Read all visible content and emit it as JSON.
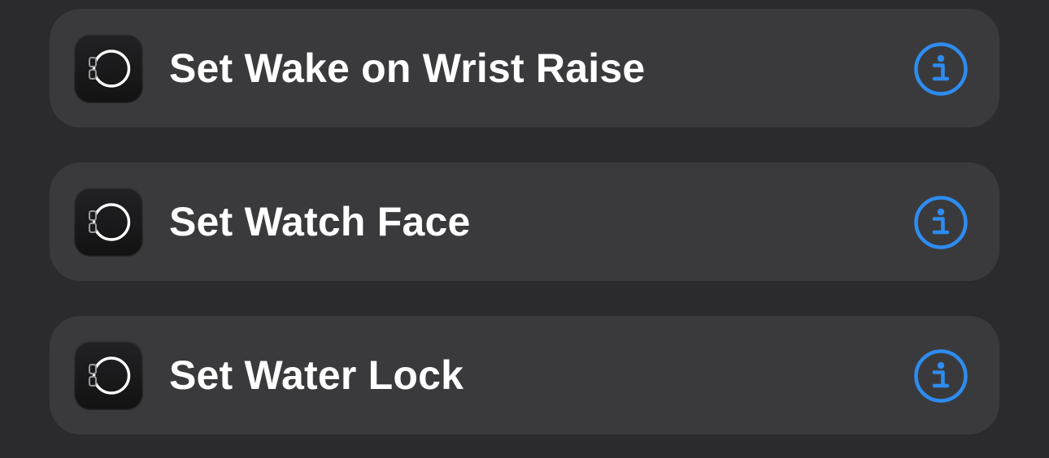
{
  "colors": {
    "background": "#2b2b2d",
    "row_background": "#3a3a3c",
    "text": "#ffffff",
    "accent": "#2e8cf0"
  },
  "actions": [
    {
      "label": "Set Wake on Wrist Raise",
      "app_icon": "watch-app-icon",
      "info_icon": "info-icon"
    },
    {
      "label": "Set Watch Face",
      "app_icon": "watch-app-icon",
      "info_icon": "info-icon"
    },
    {
      "label": "Set Water Lock",
      "app_icon": "watch-app-icon",
      "info_icon": "info-icon"
    }
  ]
}
